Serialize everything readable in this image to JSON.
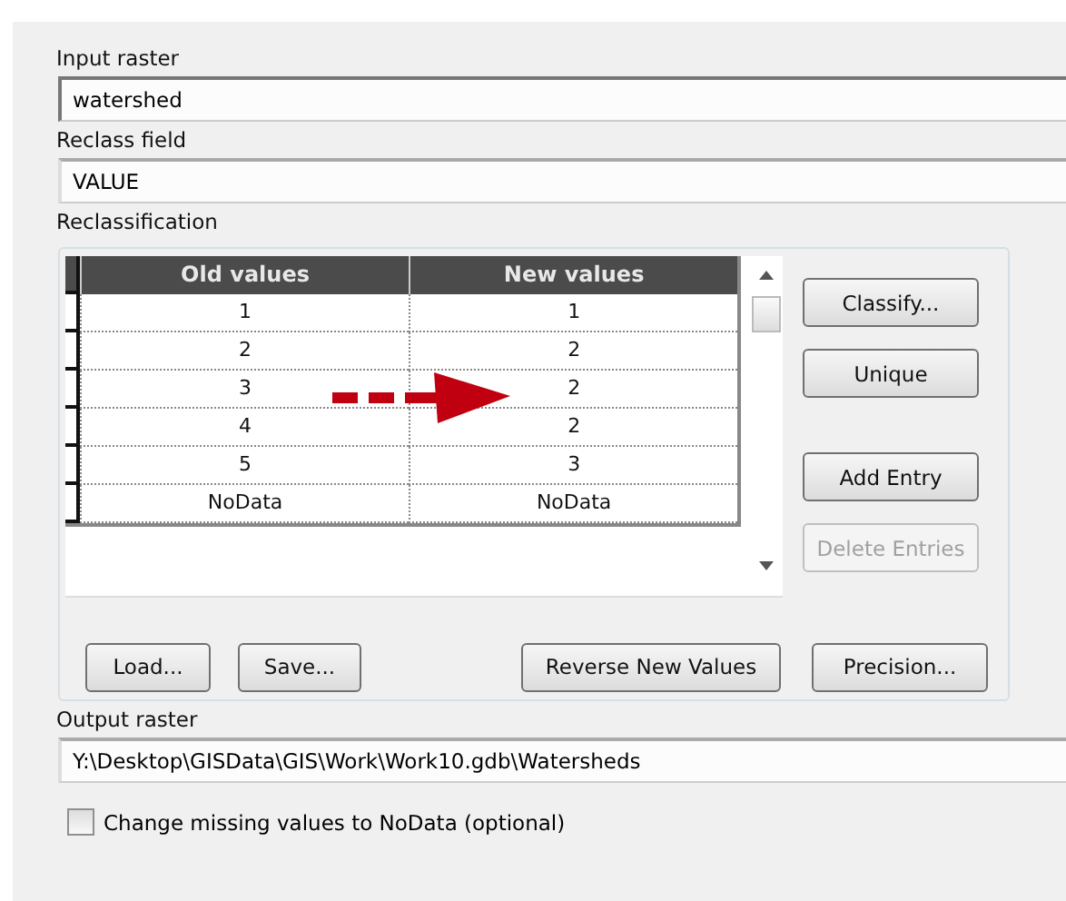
{
  "input_raster": {
    "label": "Input raster",
    "value": "watershed"
  },
  "reclass_field": {
    "label": "Reclass field",
    "value": "VALUE"
  },
  "reclassification": {
    "label": "Reclassification",
    "table": {
      "columns": [
        "Old values",
        "New values"
      ],
      "rows": [
        [
          "1",
          "1"
        ],
        [
          "2",
          "2"
        ],
        [
          "3",
          "2"
        ],
        [
          "4",
          "2"
        ],
        [
          "5",
          "3"
        ],
        [
          "NoData",
          "NoData"
        ]
      ]
    },
    "side_button_groups": [
      [
        {
          "label": "Classify...",
          "disabled": false
        },
        {
          "label": "Unique",
          "disabled": false
        }
      ],
      [
        {
          "label": "Add Entry",
          "disabled": false
        },
        {
          "label": "Delete Entries",
          "disabled": true
        }
      ]
    ],
    "bottom_buttons": [
      {
        "label": "Load..."
      },
      {
        "label": "Save..."
      },
      {
        "label": "Reverse New Values"
      },
      {
        "label": "Precision..."
      }
    ]
  },
  "output_raster": {
    "label": "Output raster",
    "value": "Y:\\Desktop\\GISData\\GIS\\Work\\Work10.gdb\\Watersheds"
  },
  "change_missing": {
    "label": "Change missing values to NoData (optional)",
    "checked": false
  }
}
